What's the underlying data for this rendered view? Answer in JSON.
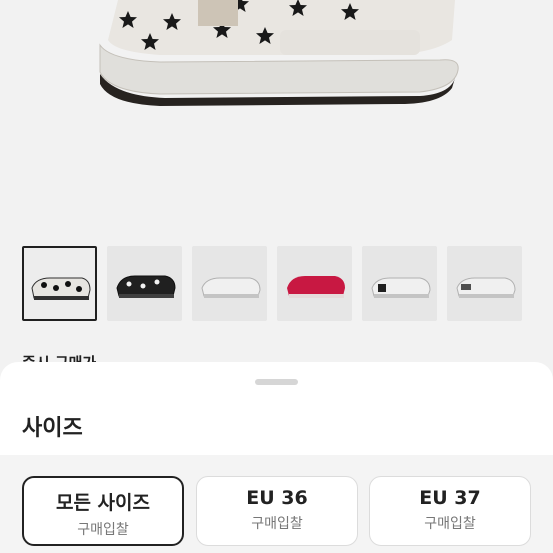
{
  "product": {
    "thumbnails": [
      {
        "name": "thumb-1",
        "variant": "black-star"
      },
      {
        "name": "thumb-2",
        "variant": "black-star-2"
      },
      {
        "name": "thumb-3",
        "variant": "white"
      },
      {
        "name": "thumb-4",
        "variant": "red"
      },
      {
        "name": "thumb-5",
        "variant": "white-black"
      },
      {
        "name": "thumb-6",
        "variant": "white-grey"
      }
    ],
    "partial_section_label": "즉시 구매가"
  },
  "sheet": {
    "title": "사이즈",
    "options": [
      {
        "size": "모든 사이즈",
        "sub": "구매입찰",
        "selected": true
      },
      {
        "size": "EU 36",
        "sub": "구매입찰",
        "selected": false
      },
      {
        "size": "EU 37",
        "sub": "구매입찰",
        "selected": false
      }
    ]
  },
  "colors": {
    "accent": "#222222",
    "sheet_bg": "#ffffff",
    "option_area_bg": "#f4f4f4"
  }
}
